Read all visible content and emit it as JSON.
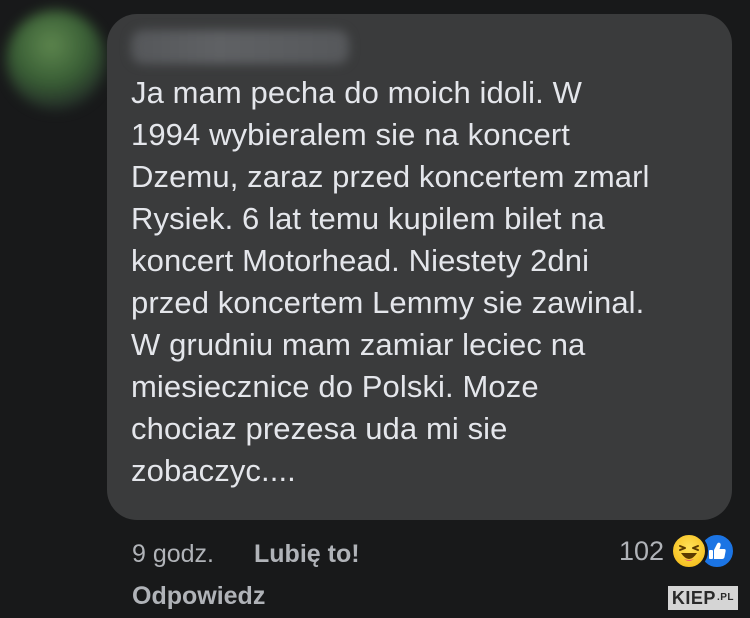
{
  "comment": {
    "text": "Ja mam pecha do moich idoli. W\n1994 wybieralem sie na koncert\nDzemu, zaraz przed koncertem zmarl\nRysiek. 6 lat temu kupilem bilet na\nkoncert Motorhead. Niestety 2dni\nprzed koncertem Lemmy sie zawinal.\nW grudniu mam zamiar leciec na\nmiesiecznice do Polski. Moze\nchociaz prezesa uda mi sie\nzobaczyc...."
  },
  "meta": {
    "time": "9 godz.",
    "like_label": "Lubię to!",
    "reply_label": "Odpowiedz"
  },
  "reactions": {
    "count": "102",
    "icons": [
      "haha-icon",
      "like-icon"
    ],
    "haha_color": "#f7c325",
    "like_color": "#1b74e4"
  },
  "watermark": {
    "brand": "KIEP",
    "tld": ".PL"
  },
  "colors": {
    "background": "#18191a",
    "bubble": "#3a3b3c",
    "text": "#e4e6eb",
    "secondary_text": "#b0b3b8"
  }
}
